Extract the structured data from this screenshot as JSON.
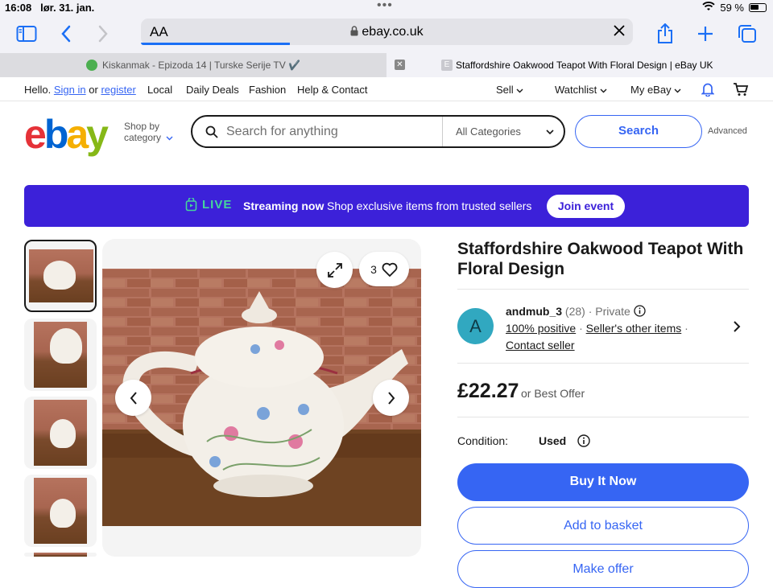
{
  "status_bar": {
    "time": "16:08",
    "date": "lør. 31. jan.",
    "battery": "59 %"
  },
  "browser": {
    "aa_label": "AA",
    "url": "ebay.co.uk",
    "tabs": [
      {
        "title": "Kiskanmak - Epizoda 14 | Turske Serije TV ✔️",
        "favicon_color": "#4caf50"
      },
      {
        "title": "Staffordshire Oakwood Teapot With Floral Design | eBay UK",
        "favicon_letter": "E"
      }
    ]
  },
  "topnav": {
    "hello": "Hello.",
    "sign_in": "Sign in",
    "or": "or",
    "register": "register",
    "links": [
      "Local",
      "Daily Deals",
      "Fashion",
      "Help & Contact"
    ],
    "sell": "Sell",
    "watchlist": "Watchlist",
    "my_ebay": "My eBay"
  },
  "header": {
    "logo_letters": [
      "e",
      "b",
      "a",
      "y"
    ],
    "logo_colors": [
      "#e53238",
      "#0064d2",
      "#f5af02",
      "#86b817"
    ],
    "shop_by": "Shop by",
    "category": "category",
    "search_placeholder": "Search for anything",
    "category_select": "All Categories",
    "search_button": "Search",
    "advanced": "Advanced"
  },
  "banner": {
    "live": "LIVE",
    "streaming": "Streaming now",
    "text": "Shop exclusive items from trusted sellers",
    "join": "Join event",
    "bg_color": "#3c21d9"
  },
  "gallery": {
    "watch_count": "3"
  },
  "listing": {
    "title": "Staffordshire Oakwood Teapot With Floral Design",
    "seller_initial": "A",
    "seller_name": "andmub_3",
    "seller_feedback": "(28)",
    "seller_type": "· Private",
    "positive": "100% positive",
    "other_items": "Seller's other items",
    "contact": "Contact seller",
    "price": "£22.27",
    "best_offer": "or Best Offer",
    "condition_label": "Condition:",
    "condition_value": "Used",
    "buy_now": "Buy It Now",
    "add_to_basket": "Add to basket",
    "make_offer": "Make offer"
  }
}
